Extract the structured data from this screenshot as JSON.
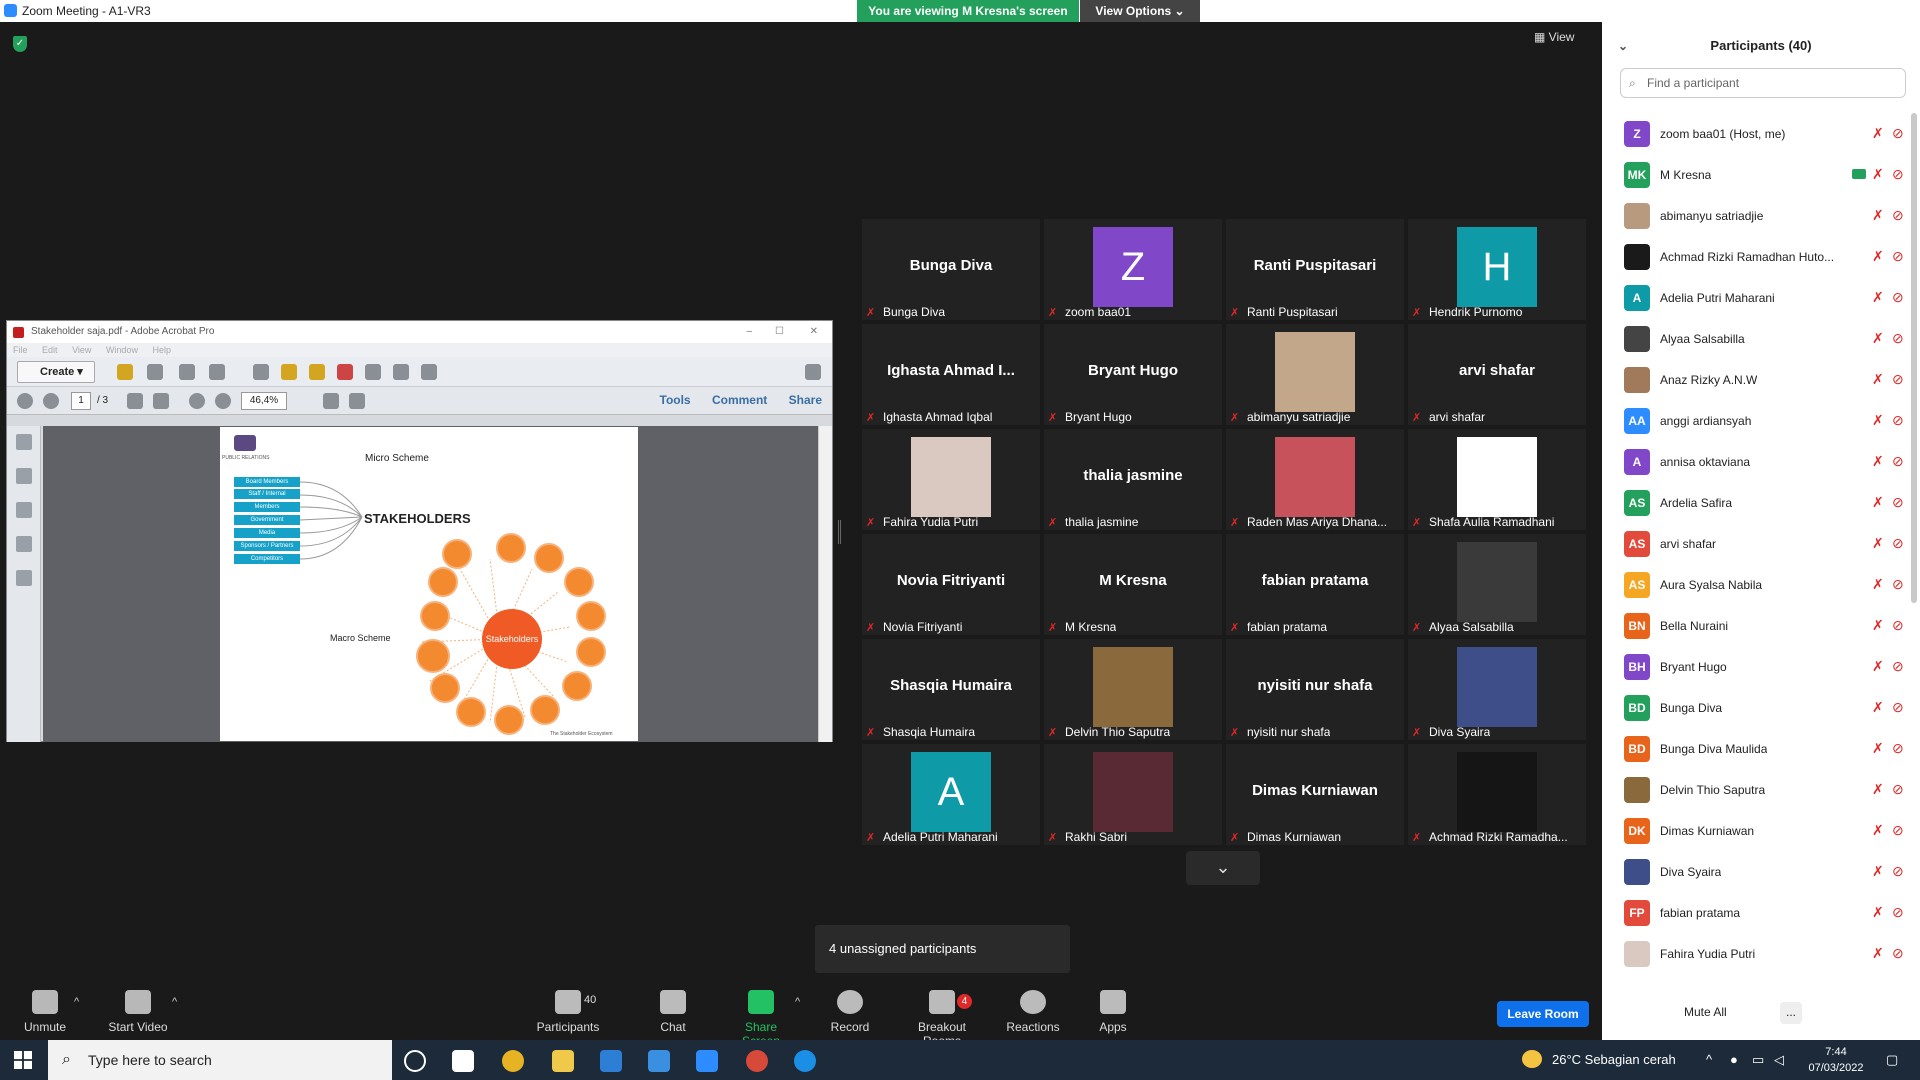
{
  "window": {
    "title": "Zoom Meeting - A1-VR3"
  },
  "banner": {
    "viewing": "You are viewing M Kresna's screen",
    "view_options": "View Options ⌄"
  },
  "view_button": "View",
  "acrobat": {
    "title": "Stakeholder saja.pdf - Adobe Acrobat Pro",
    "menu": [
      "File",
      "Edit",
      "View",
      "Window",
      "Help"
    ],
    "create": "Create",
    "page": "1",
    "page_total": "/ 3",
    "zoom": "46,4%",
    "tabs": [
      "Tools",
      "Comment",
      "Share"
    ],
    "doc": {
      "logo_text": "PUBLIC RELATIONS",
      "micro": "Micro Scheme",
      "stakeholders": "STAKEHOLDERS",
      "boxes": [
        "Board Members",
        "Staff / Internal",
        "Members",
        "Government",
        "Media",
        "Sponsors / Partners",
        "Competitors"
      ],
      "macro": "Macro Scheme",
      "center": "Stakeholders",
      "footer": "The Stakeholder Ecosystem"
    }
  },
  "tiles": [
    {
      "name": "Bunga Diva",
      "label": "Bunga Diva",
      "type": "text"
    },
    {
      "name": "Z",
      "label": "zoom baa01",
      "type": "avatar",
      "color": "#8147c9"
    },
    {
      "name": "Ranti Puspitasari",
      "label": "Ranti Puspitasari",
      "type": "text"
    },
    {
      "name": "H",
      "label": "Hendrik Purnomo",
      "type": "avatar",
      "color": "#0e9aa7"
    },
    {
      "name": "Ighasta Ahmad I...",
      "label": "Ighasta Ahmad Iqbal",
      "type": "text"
    },
    {
      "name": "Bryant Hugo",
      "label": "Bryant Hugo",
      "type": "text"
    },
    {
      "name": "",
      "label": "abimanyu satriadjie",
      "type": "photo",
      "color": "#c2a78a"
    },
    {
      "name": "arvi shafar",
      "label": "arvi shafar",
      "type": "text"
    },
    {
      "name": "",
      "label": "Fahira Yudia Putri",
      "type": "photo",
      "color": "#d9c9c0"
    },
    {
      "name": "thalia jasmine",
      "label": "thalia jasmine",
      "type": "text"
    },
    {
      "name": "",
      "label": "Raden Mas Ariya Dhana...",
      "type": "photo",
      "color": "#c8525c"
    },
    {
      "name": "",
      "label": "Shafa Aulia Ramadhani",
      "type": "photo",
      "color": "#ffffff"
    },
    {
      "name": "Novia Fitriyanti",
      "label": "Novia Fitriyanti",
      "type": "text"
    },
    {
      "name": "M Kresna",
      "label": "M Kresna",
      "type": "text"
    },
    {
      "name": "fabian pratama",
      "label": "fabian pratama",
      "type": "text"
    },
    {
      "name": "",
      "label": "Alyaa Salsabilla",
      "type": "photo",
      "color": "#3a3a3a"
    },
    {
      "name": "Shasqia Humaira",
      "label": "Shasqia Humaira",
      "type": "text"
    },
    {
      "name": "",
      "label": "Delvin Thio Saputra",
      "type": "photo",
      "color": "#8a6a3c"
    },
    {
      "name": "nyisiti nur shafa",
      "label": "nyisiti nur shafa",
      "type": "text"
    },
    {
      "name": "",
      "label": "Diva Syaira",
      "type": "photo",
      "color": "#3d4e88"
    },
    {
      "name": "A",
      "label": "Adelia Putri Maharani",
      "type": "avatar",
      "color": "#0e9aa7"
    },
    {
      "name": "",
      "label": "Rakhi Sabri",
      "type": "photo",
      "color": "#5a2a34"
    },
    {
      "name": "Dimas Kurniawan",
      "label": "Dimas Kurniawan",
      "type": "text"
    },
    {
      "name": "",
      "label": "Achmad Rizki Ramadha...",
      "type": "photo",
      "color": "#151515"
    }
  ],
  "unassigned": "4 unassigned participants",
  "toolbar": {
    "unmute": "Unmute",
    "start_video": "Start Video",
    "participants": "Participants",
    "participants_count": "40",
    "chat": "Chat",
    "share_screen": "Share Screen",
    "record": "Record",
    "breakout": "Breakout Rooms",
    "breakout_badge": "4",
    "reactions": "Reactions",
    "apps": "Apps",
    "leave": "Leave Room"
  },
  "panel": {
    "title": "Participants (40)",
    "search_placeholder": "Find a participant",
    "participants": [
      {
        "initials": "Z",
        "name": "zoom baa01 (Host, me)",
        "color": "#8147c9"
      },
      {
        "initials": "MK",
        "name": "M Kresna",
        "color": "#23a05b",
        "sharing": true
      },
      {
        "initials": "",
        "name": "abimanyu satriadjie",
        "color": "#b89a7e"
      },
      {
        "initials": "",
        "name": "Achmad Rizki Ramadhan Huto...",
        "color": "#1a1a1a"
      },
      {
        "initials": "A",
        "name": "Adelia Putri Maharani",
        "color": "#0e9aa7"
      },
      {
        "initials": "",
        "name": "Alyaa Salsabilla",
        "color": "#444444"
      },
      {
        "initials": "",
        "name": "Anaz Rizky A.N.W",
        "color": "#a07a5a"
      },
      {
        "initials": "AA",
        "name": "anggi ardiansyah",
        "color": "#2d8cff"
      },
      {
        "initials": "A",
        "name": "annisa oktaviana",
        "color": "#8147c9"
      },
      {
        "initials": "AS",
        "name": "Ardelia Safira",
        "color": "#23a05b"
      },
      {
        "initials": "AS",
        "name": "arvi shafar",
        "color": "#e24a3b"
      },
      {
        "initials": "AS",
        "name": "Aura Syalsa Nabila",
        "color": "#f5a623"
      },
      {
        "initials": "BN",
        "name": "Bella Nuraini",
        "color": "#e8641b"
      },
      {
        "initials": "BH",
        "name": "Bryant Hugo",
        "color": "#8147c9"
      },
      {
        "initials": "BD",
        "name": "Bunga Diva",
        "color": "#23a05b"
      },
      {
        "initials": "BD",
        "name": "Bunga Diva Maulida",
        "color": "#e8641b"
      },
      {
        "initials": "",
        "name": "Delvin Thio Saputra",
        "color": "#8a6a3c"
      },
      {
        "initials": "DK",
        "name": "Dimas Kurniawan",
        "color": "#e8641b"
      },
      {
        "initials": "",
        "name": "Diva Syaira",
        "color": "#3d4e88"
      },
      {
        "initials": "FP",
        "name": "fabian pratama",
        "color": "#e24a3b"
      },
      {
        "initials": "",
        "name": "Fahira Yudia Putri",
        "color": "#d9c9c0"
      }
    ],
    "mute_all": "Mute All",
    "more": "..."
  },
  "taskbar": {
    "search": "Type here to search",
    "weather": "26°C  Sebagian cerah",
    "time": "7:44",
    "date": "07/03/2022"
  }
}
